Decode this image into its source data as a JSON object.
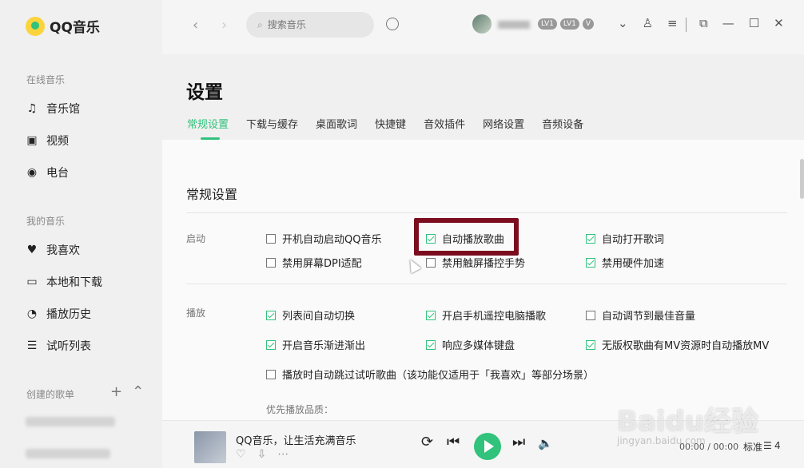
{
  "app": {
    "name": "QQ音乐"
  },
  "sidebar": {
    "online_title": "在线音乐",
    "online_items": [
      {
        "label": "音乐馆",
        "icon": "music-note-icon"
      },
      {
        "label": "视频",
        "icon": "video-icon"
      },
      {
        "label": "电台",
        "icon": "radio-icon"
      }
    ],
    "mine_title": "我的音乐",
    "mine_items": [
      {
        "label": "我喜欢",
        "icon": "heart-icon"
      },
      {
        "label": "本地和下载",
        "icon": "monitor-icon"
      },
      {
        "label": "播放历史",
        "icon": "history-icon"
      },
      {
        "label": "试听列表",
        "icon": "playlist-icon"
      }
    ],
    "created_title": "创建的歌单"
  },
  "topbar": {
    "search_placeholder": "搜索音乐",
    "badges": [
      "LV1",
      "LV1",
      "V"
    ]
  },
  "settings": {
    "page_title": "设置",
    "tabs": [
      "常规设置",
      "下载与缓存",
      "桌面歌词",
      "快捷键",
      "音效插件",
      "网络设置",
      "音频设备"
    ],
    "active_tab": "常规设置",
    "section_title": "常规设置",
    "startup": {
      "label": "启动",
      "options": [
        {
          "label": "开机自动启动QQ音乐",
          "checked": false
        },
        {
          "label": "自动播放歌曲",
          "checked": true
        },
        {
          "label": "自动打开歌词",
          "checked": true
        },
        {
          "label": "禁用屏幕DPI适配",
          "checked": false
        },
        {
          "label": "禁用触屏播控手势",
          "checked": false
        },
        {
          "label": "禁用硬件加速",
          "checked": true
        }
      ]
    },
    "playback": {
      "label": "播放",
      "options": [
        {
          "label": "列表间自动切换",
          "checked": true
        },
        {
          "label": "开启手机遥控电脑播歌",
          "checked": true
        },
        {
          "label": "自动调节到最佳音量",
          "checked": false
        },
        {
          "label": "开启音乐渐进渐出",
          "checked": true
        },
        {
          "label": "响应多媒体键盘",
          "checked": true
        },
        {
          "label": "无版权歌曲有MV资源时自动播放MV",
          "checked": true
        },
        {
          "label": "播放时自动跳过试听歌曲（该功能仅适用于「我喜欢」等部分场景）",
          "checked": false
        }
      ],
      "quality_label": "优先播放品质："
    }
  },
  "player": {
    "song_title": "QQ音乐，让生活充满音乐",
    "time": "00:00 / 00:00",
    "quality": "标准",
    "queue_count": "4"
  },
  "watermark": {
    "main": "Baidu经验",
    "sub": "jingyan.baidu.com"
  },
  "colors": {
    "accent": "#31c27c",
    "highlight_box": "#7b0d1e"
  }
}
